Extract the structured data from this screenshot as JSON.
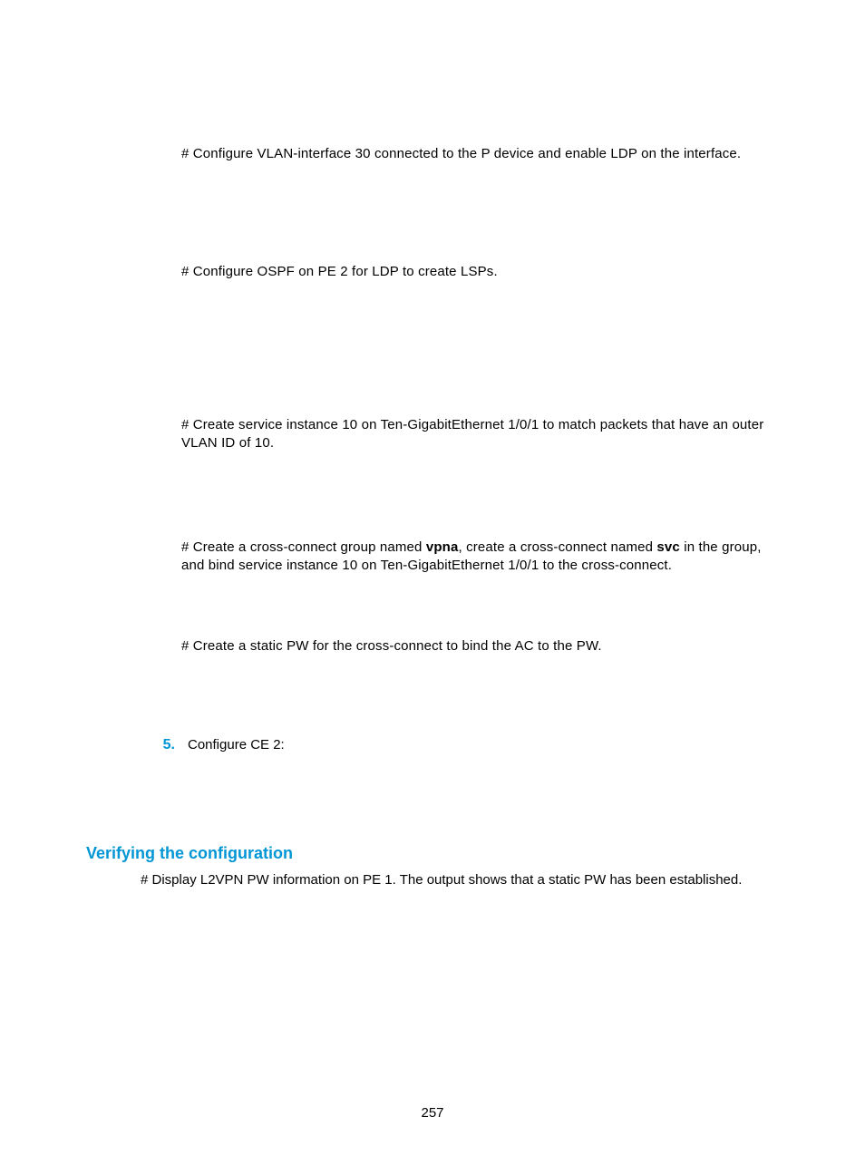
{
  "p1": "# Configure VLAN-interface 30 connected to the P device and enable LDP on the interface.",
  "p2": "# Configure OSPF on PE 2 for LDP to create LSPs.",
  "p3_a": "# Create service instance 10 on Ten-GigabitEthernet 1/0/1 to match packets that have an outer VLAN ID of 10.",
  "p4_pre": "# Create a cross-connect group named ",
  "p4_b1": "vpna",
  "p4_mid": ", create a cross-connect named ",
  "p4_b2": "svc",
  "p4_post": " in the group, and bind service instance 10 on Ten-GigabitEthernet 1/0/1 to the cross-connect.",
  "p5": "# Create a static PW for the cross-connect to bind the AC to the PW.",
  "list5_num": "5.",
  "list5_body": "Configure CE 2:",
  "heading": "Verifying the configuration",
  "p6": "# Display L2VPN PW information on PE 1. The output shows that a static PW has been established.",
  "page_number": "257"
}
